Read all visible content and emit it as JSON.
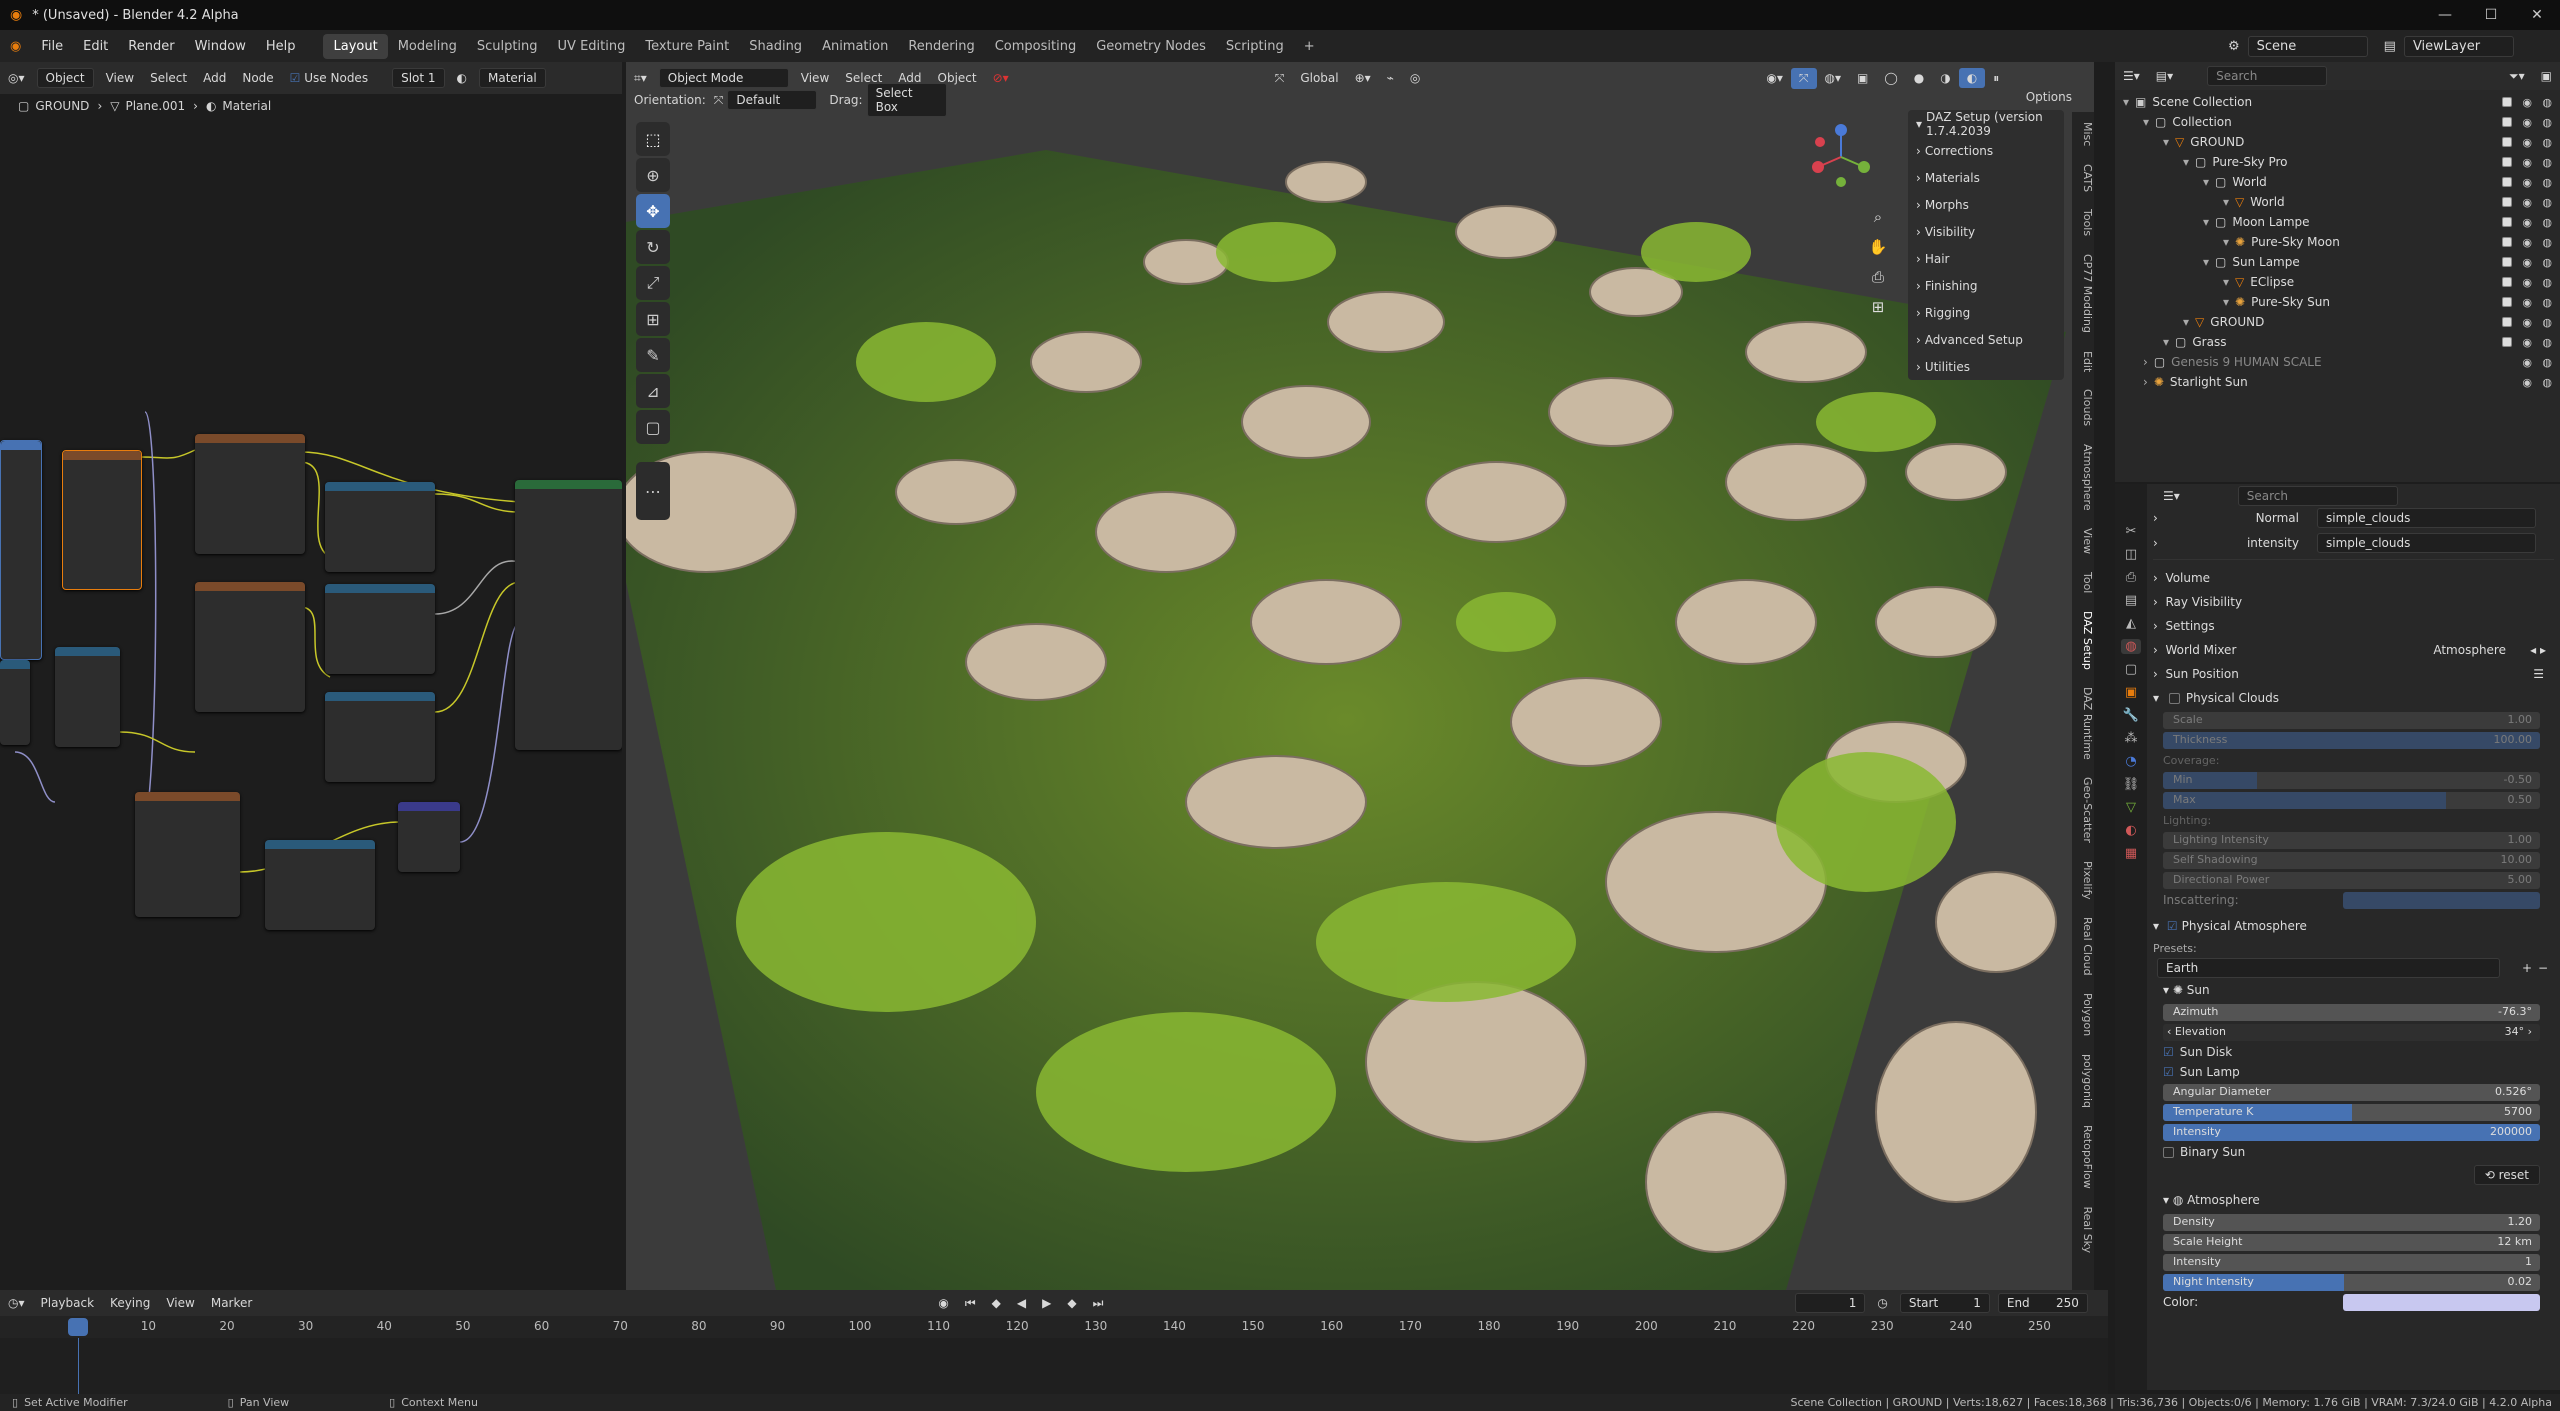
{
  "window": {
    "title": "* (Unsaved) - Blender 4.2 Alpha"
  },
  "top_menu": [
    "File",
    "Edit",
    "Render",
    "Window",
    "Help"
  ],
  "workspaces": [
    "Layout",
    "Modeling",
    "Sculpting",
    "UV Editing",
    "Texture Paint",
    "Shading",
    "Animation",
    "Rendering",
    "Compositing",
    "Geometry Nodes",
    "Scripting"
  ],
  "active_workspace": "Layout",
  "scene": {
    "name": "Scene",
    "view_layer": "ViewLayer"
  },
  "node_editor": {
    "header": {
      "object": "Object",
      "menus": [
        "View",
        "Select",
        "Add",
        "Node"
      ],
      "use_nodes": "Use Nodes",
      "slot": "Slot 1",
      "material": "Material"
    },
    "breadcrumb": [
      "GROUND",
      "Plane.001",
      "Material"
    ]
  },
  "viewport": {
    "header": {
      "mode": "Object Mode",
      "menus": [
        "View",
        "Select",
        "Add",
        "Object"
      ],
      "transform": "Global"
    },
    "tool_settings": {
      "orientation_label": "Orientation:",
      "orientation": "Default",
      "drag_label": "Drag:",
      "drag": "Select Box",
      "options": "Options"
    },
    "daz_panel": {
      "title": "DAZ Setup (version 1.7.4.2039",
      "items": [
        "Corrections",
        "Materials",
        "Morphs",
        "Visibility",
        "Hair",
        "Finishing",
        "Rigging",
        "Advanced Setup",
        "Utilities"
      ]
    },
    "sidebar_tabs": [
      "Misc",
      "CATS",
      "Tools",
      "CP77 Modding",
      "Edit",
      "Clouds",
      "Atmosphere",
      "View",
      "Tool",
      "DAZ Setup",
      "DAZ Runtime",
      "Geo-Scatter",
      "Pixelify",
      "Real Cloud",
      "Polygon",
      "polygoniq",
      "RetopoFlow",
      "Real Sky"
    ]
  },
  "outliner": {
    "search_placeholder": "Search",
    "rows": [
      {
        "label": "Scene Collection",
        "indent": 0,
        "icon": "scene-collection-icon"
      },
      {
        "label": "Collection",
        "indent": 1,
        "icon": "collection-icon"
      },
      {
        "label": "GROUND",
        "indent": 2,
        "icon": "object-icon"
      },
      {
        "label": "Pure-Sky Pro",
        "indent": 3,
        "icon": "collection-icon"
      },
      {
        "label": "World",
        "indent": 4,
        "icon": "collection-icon"
      },
      {
        "label": "World",
        "indent": 5,
        "icon": "object-icon"
      },
      {
        "label": "Moon Lampe",
        "indent": 4,
        "icon": "collection-icon"
      },
      {
        "label": "Pure-Sky Moon",
        "indent": 5,
        "icon": "light-icon"
      },
      {
        "label": "Sun Lampe",
        "indent": 4,
        "icon": "collection-icon"
      },
      {
        "label": "EClipse",
        "indent": 5,
        "icon": "object-icon"
      },
      {
        "label": "Pure-Sky Sun",
        "indent": 5,
        "icon": "light-icon"
      },
      {
        "label": "GROUND",
        "indent": 3,
        "icon": "object-icon"
      },
      {
        "label": "Grass",
        "indent": 2,
        "icon": "collection-icon"
      },
      {
        "label": "Genesis 9 HUMAN SCALE",
        "indent": 1,
        "icon": "collection-icon"
      },
      {
        "label": "Starlight Sun",
        "indent": 1,
        "icon": "light-icon"
      }
    ]
  },
  "properties": {
    "search_placeholder": "Search",
    "links": [
      {
        "label": "Normal",
        "value": "simple_clouds"
      },
      {
        "label": "intensity",
        "value": "simple_clouds"
      }
    ],
    "panels": [
      "Volume",
      "Ray Visibility",
      "Settings"
    ],
    "world_mixer": {
      "label": "World Mixer",
      "value": "Atmosphere"
    },
    "sun_position": "Sun Position",
    "physical_clouds": {
      "title": "Physical Clouds",
      "scale": {
        "label": "Scale",
        "value": "1.00"
      },
      "thickness": {
        "label": "Thickness",
        "value": "100.00",
        "fill": 1.0
      },
      "coverage_label": "Coverage:",
      "min": {
        "label": "Min",
        "value": "-0.50",
        "fill": 0.25
      },
      "max": {
        "label": "Max",
        "value": "0.50",
        "fill": 0.75
      },
      "lighting_label": "Lighting:",
      "lighting_intensity": {
        "label": "Lighting Intensity",
        "value": "1.00"
      },
      "self_shadowing": {
        "label": "Self Shadowing",
        "value": "10.00"
      },
      "directional_power": {
        "label": "Directional Power",
        "value": "5.00"
      },
      "inscattering_label": "Inscattering:"
    },
    "physical_atmosphere": {
      "title": "Physical Atmosphere",
      "presets_label": "Presets:",
      "preset": "Earth",
      "sun_title": "Sun",
      "azimuth": {
        "label": "Azimuth",
        "value": "-76.3°"
      },
      "elevation": {
        "label": "Elevation",
        "value": "34°"
      },
      "sun_disk": "Sun Disk",
      "sun_lamp": "Sun Lamp",
      "angular_diameter": {
        "label": "Angular Diameter",
        "value": "0.526°"
      },
      "temperature": {
        "label": "Temperature K",
        "value": "5700",
        "fill": 0.5
      },
      "intensity": {
        "label": "Intensity",
        "value": "200000",
        "fill": 1.0
      },
      "binary_sun": "Binary Sun",
      "reset": "reset",
      "atmosphere_title": "Atmosphere",
      "density": {
        "label": "Density",
        "value": "1.20"
      },
      "scale_height": {
        "label": "Scale Height",
        "value": "12 km"
      },
      "atm_intensity": {
        "label": "Intensity",
        "value": "1"
      },
      "night_intensity": {
        "label": "Night Intensity",
        "value": "0.02",
        "fill": 0.48
      },
      "color_label": "Color:"
    }
  },
  "timeline": {
    "menus": [
      "Playback",
      "Keying",
      "View",
      "Marker"
    ],
    "current_frame": "1",
    "start_label": "Start",
    "start": "1",
    "end_label": "End",
    "end": "250",
    "ticks": [
      "1",
      "10",
      "20",
      "30",
      "40",
      "50",
      "60",
      "70",
      "80",
      "90",
      "100",
      "110",
      "120",
      "130",
      "140",
      "150",
      "160",
      "170",
      "180",
      "190",
      "200",
      "210",
      "220",
      "230",
      "240",
      "250"
    ]
  },
  "statusbar": {
    "left": [
      "Set Active Modifier",
      "Pan View",
      "Context Menu"
    ],
    "right": "Scene Collection | GROUND | Verts:18,627 | Faces:18,368 | Tris:36,736 | Objects:0/6 | Memory: 1.76 GiB | VRAM: 7.3/24.0 GiB | 4.2.0 Alpha"
  },
  "colors": {
    "accent": "#4772b3",
    "panel": "#282828",
    "header": "#2b2b2b",
    "viewport": "#3b3b3b"
  }
}
